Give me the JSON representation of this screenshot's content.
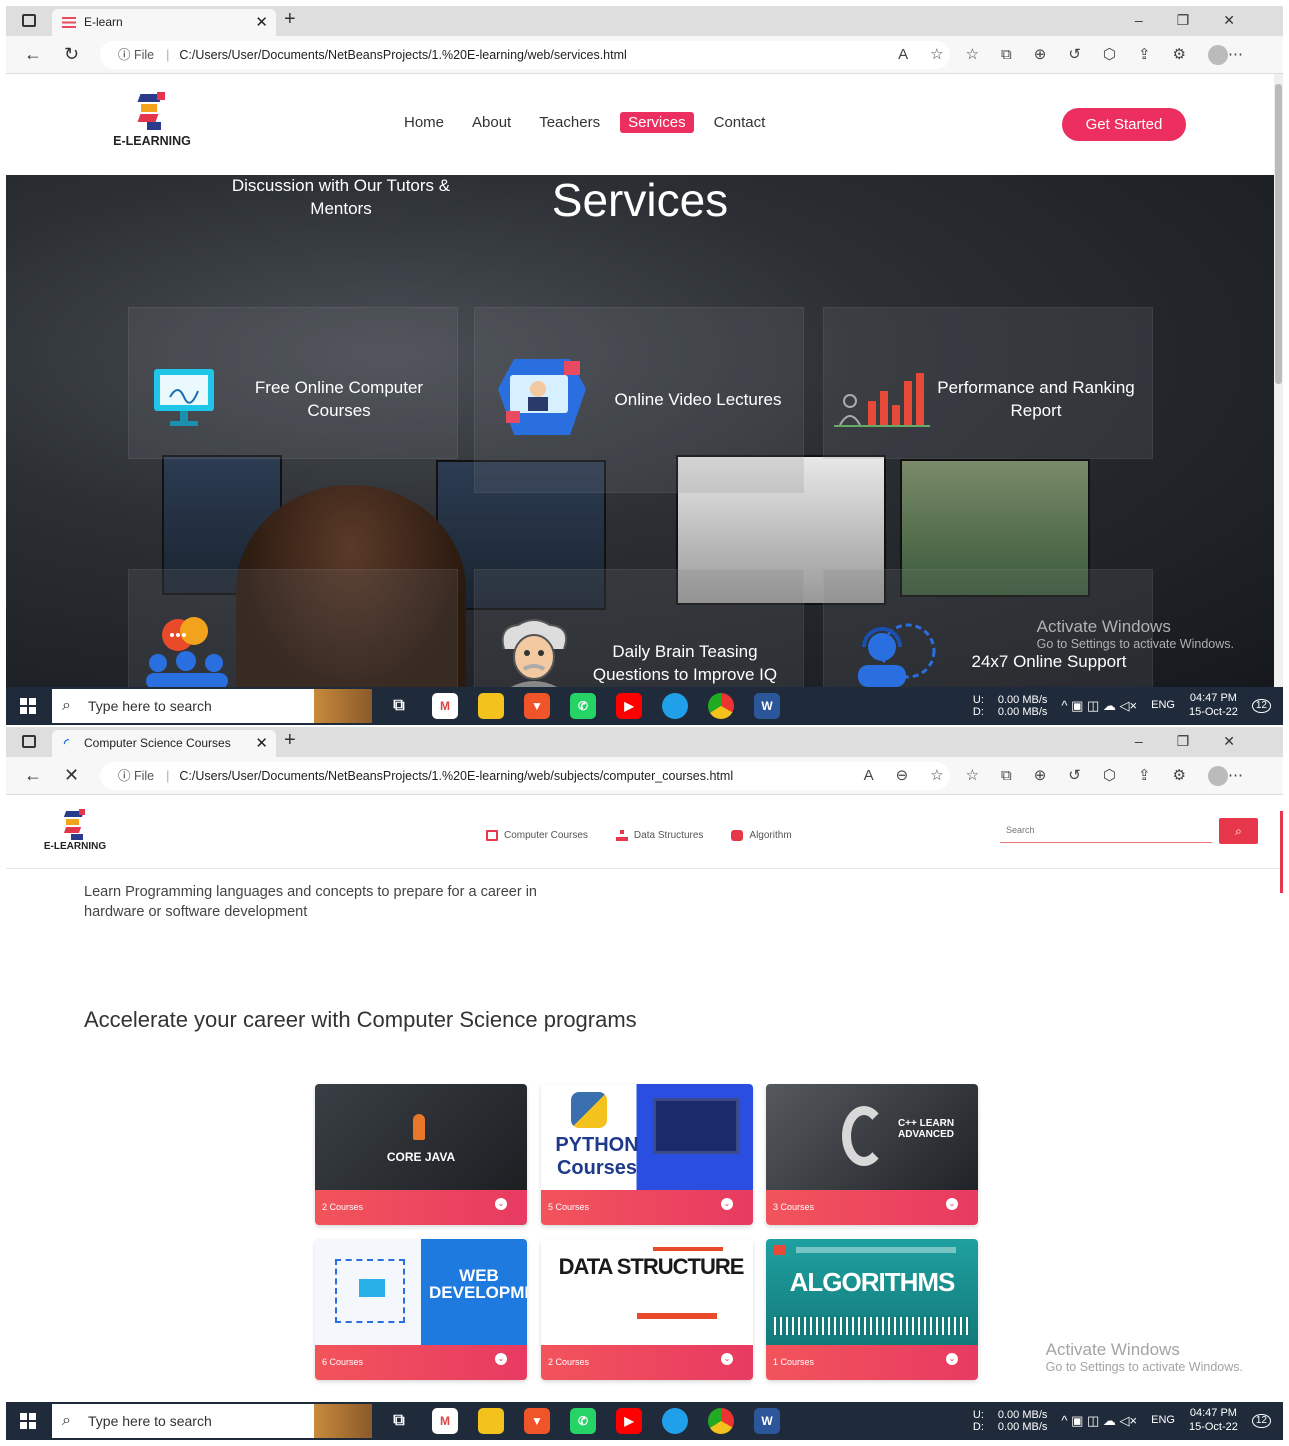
{
  "screen1": {
    "browser": {
      "tab_title": "E-learn",
      "file_label": "File",
      "url": "C:/Users/User/Documents/NetBeansProjects/1.%20E-learning/web/services.html"
    },
    "site": {
      "logo_text": "E-LEARNING",
      "nav": [
        "Home",
        "About",
        "Teachers",
        "Services",
        "Contact"
      ],
      "active_nav": "Services",
      "cta": "Get Started"
    },
    "hero": {
      "title": "Services",
      "services": [
        {
          "label": "Free Online Computer Courses",
          "icon": "monitor-icon"
        },
        {
          "label": "Online Video Lectures",
          "icon": "video-lecture-icon"
        },
        {
          "label": "Performance and Ranking Report",
          "icon": "bar-chart-icon"
        },
        {
          "label": "Discussion with Our Tutors & Mentors",
          "icon": "discussion-icon"
        },
        {
          "label": "Daily Brain Teasing Questions to Improve IQ",
          "icon": "einstein-icon"
        },
        {
          "label": "24x7 Online Support",
          "icon": "headset-icon"
        }
      ]
    },
    "watermark": {
      "title": "Activate Windows",
      "subtitle": "Go to Settings to activate Windows."
    }
  },
  "screen2": {
    "browser": {
      "tab_title": "Computer Science Courses",
      "file_label": "File",
      "url": "C:/Users/User/Documents/NetBeansProjects/1.%20E-learning/web/subjects/computer_courses.html"
    },
    "site": {
      "logo_text": "E-LEARNING",
      "nav": [
        {
          "label": "Computer Courses",
          "icon": "laptop-icon"
        },
        {
          "label": "Data Structures",
          "icon": "sitemap-icon"
        },
        {
          "label": "Algorithm",
          "icon": "cubes-icon"
        }
      ],
      "search_placeholder": "Search"
    },
    "intro": "Learn Programming languages and concepts to prepare for a career in hardware or software development",
    "heading": "Accelerate your career with Computer Science programs",
    "cards": [
      {
        "title": "CORE JAVA",
        "count": "2 Courses"
      },
      {
        "title": "PYTHON Courses",
        "count": "5 Courses"
      },
      {
        "title": "C++ LEARN ADVANCED",
        "count": "3 Courses"
      },
      {
        "title": "WEB DEVELOPMENT",
        "count": "6 Courses"
      },
      {
        "title": "DATA STRUCTURE",
        "count": "2 Courses"
      },
      {
        "title": "ALGORITHMS",
        "count": "1 Courses"
      }
    ],
    "watermark": {
      "title": "Activate Windows",
      "subtitle": "Go to Settings to activate Windows."
    }
  },
  "taskbar": {
    "search_placeholder": "Type here to search",
    "net_up": "U:",
    "net_down": "D:",
    "net_up_rate": "0.00 MB/s",
    "net_down_rate": "0.00 MB/s",
    "lang": "ENG",
    "time": "04:47 PM",
    "date": "15-Oct-22",
    "notifications": "12"
  }
}
